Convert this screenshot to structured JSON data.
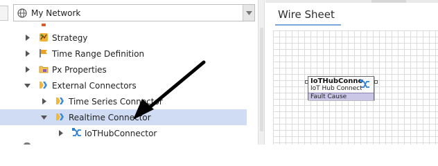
{
  "nav": {
    "network_select": {
      "value": "My Network"
    },
    "tree": [
      {
        "label": "Strategy",
        "icon": "strategy-icon",
        "expanded": false
      },
      {
        "label": "Time Range Definition",
        "icon": "flag-icon",
        "expanded": false
      },
      {
        "label": "Px Properties",
        "icon": "folder-px-icon",
        "expanded": false
      },
      {
        "label": "External Connectors",
        "icon": "connector-folder-icon",
        "expanded": true
      },
      {
        "label": "Time Series Connector",
        "icon": "connector-folder-icon",
        "expanded": false
      },
      {
        "label": "Realtime Connector",
        "icon": "connector-folder-icon",
        "expanded": true,
        "selected": true
      },
      {
        "label": "IoTHubConnector",
        "icon": "iot-hub-connector-icon",
        "expanded": false
      }
    ]
  },
  "sheet": {
    "tab_label": "Wire Sheet",
    "block": {
      "title": "IoTHubConnector",
      "subtitle": "IoT Hub Connector",
      "slot": "Fault Cause",
      "icon": "iot-hub-connector-icon"
    }
  },
  "colors": {
    "selection": "#cfdcf3",
    "tab_underline": "#7aa6d9",
    "slot_fill": "#c9c6e6",
    "connector_icon": "#2f7fd0"
  }
}
